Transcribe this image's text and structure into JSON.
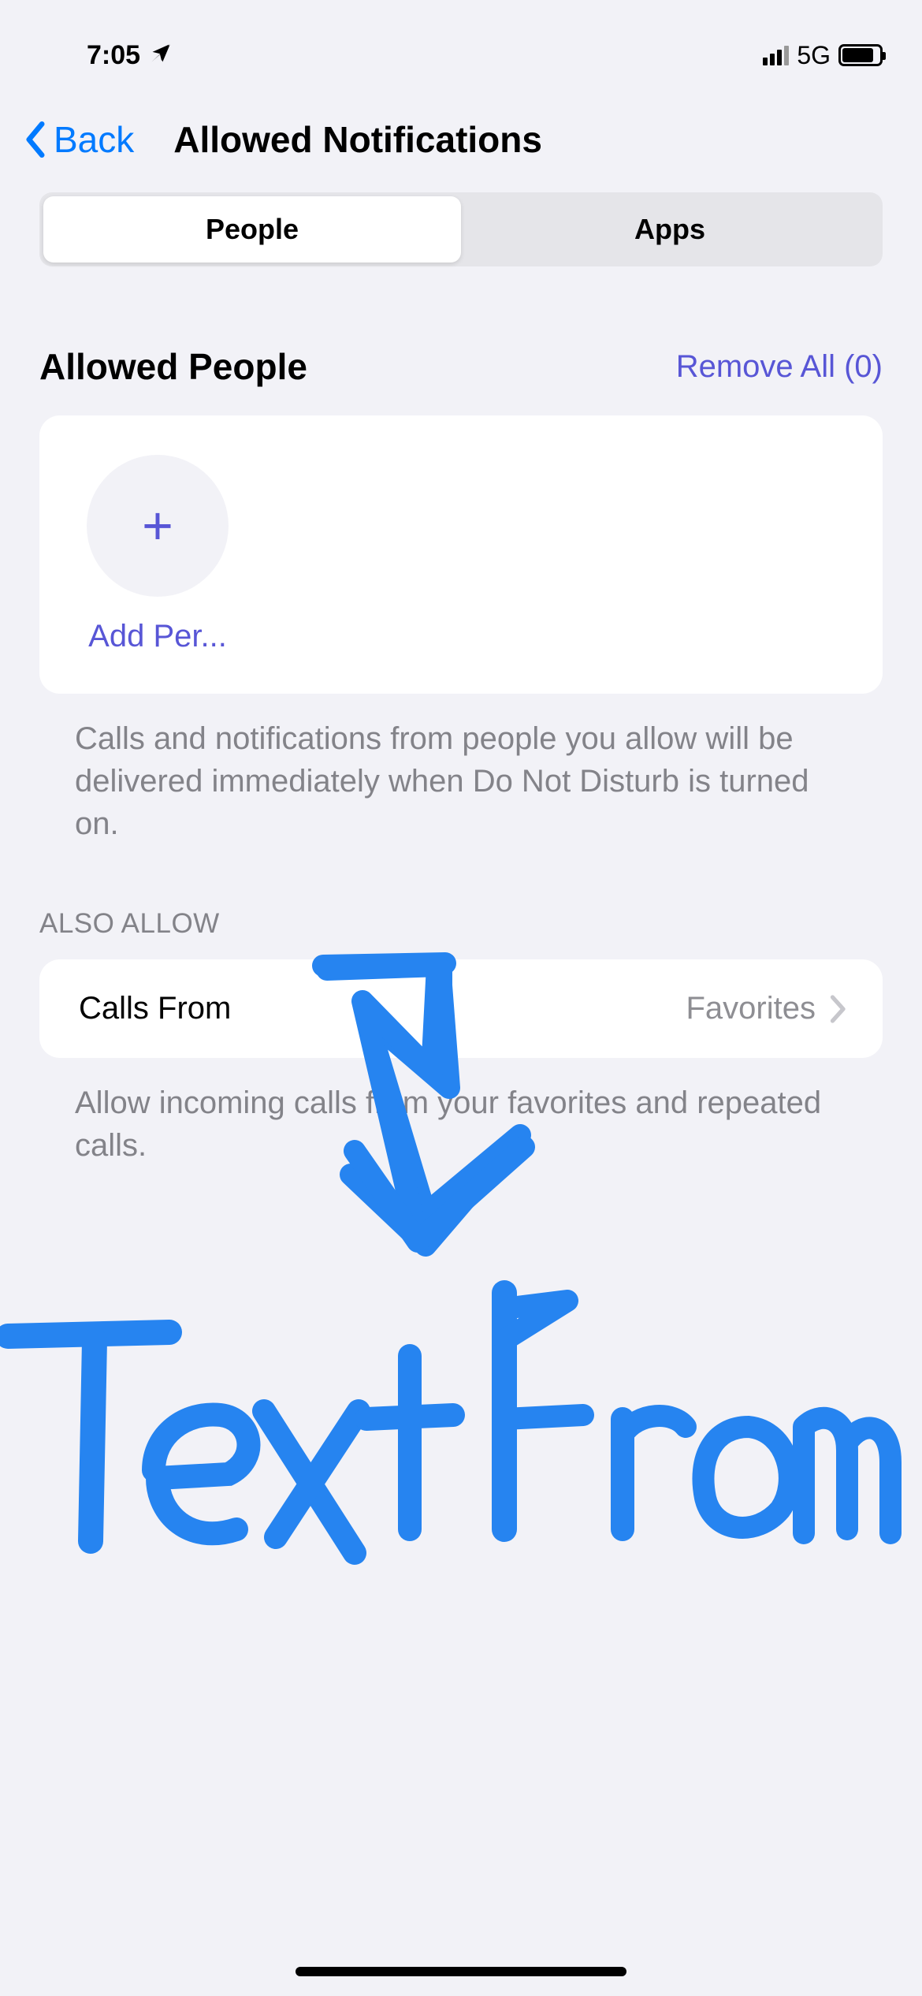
{
  "statusBar": {
    "time": "7:05",
    "network": "5G"
  },
  "nav": {
    "backLabel": "Back",
    "title": "Allowed Notifications"
  },
  "tabs": {
    "people": "People",
    "apps": "Apps"
  },
  "allowedPeople": {
    "title": "Allowed People",
    "removeAll": "Remove All (0)",
    "addLabel": "Add Per...",
    "footer": "Calls and notifications from people you allow will be delivered immediately when Do Not Disturb is turned on."
  },
  "alsoAllow": {
    "label": "ALSO ALLOW",
    "callsFrom": {
      "label": "Calls From",
      "value": "Favorites"
    },
    "footer": "Allow incoming calls from your favorites and repeated calls."
  },
  "annotation": {
    "text": "Text From"
  }
}
